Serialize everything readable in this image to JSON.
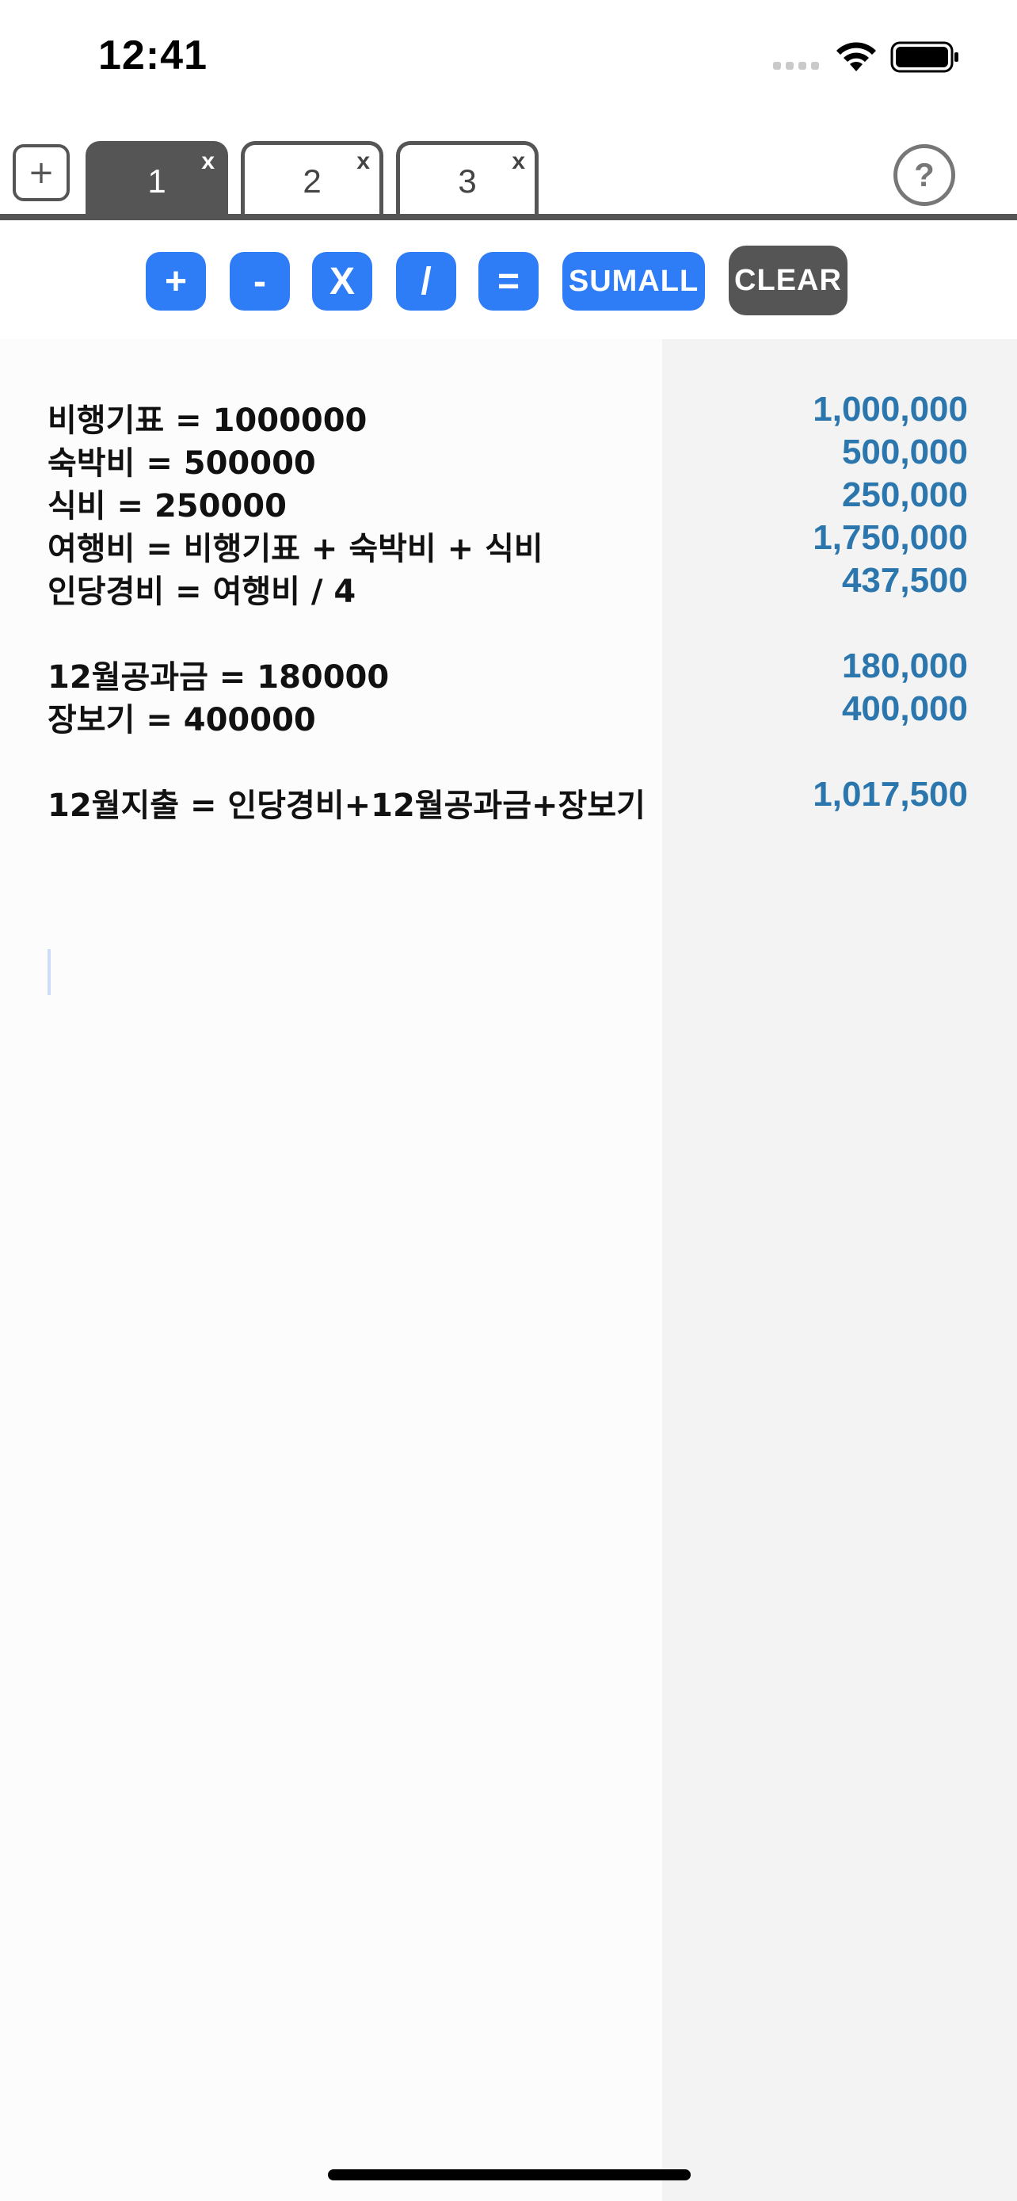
{
  "status_bar": {
    "time": "12:41"
  },
  "tabs": {
    "add_label": "+",
    "close_label": "x",
    "items": [
      {
        "label": "1",
        "active": true
      },
      {
        "label": "2",
        "active": false
      },
      {
        "label": "3",
        "active": false
      }
    ],
    "help_label": "?"
  },
  "toolbar": {
    "plus": "+",
    "minus": "-",
    "multiply": "X",
    "divide": "/",
    "equals": "=",
    "sumall": "SUMALL",
    "clear": "CLEAR"
  },
  "editor": {
    "lines": [
      "비행기표 = 1000000",
      "숙박비 = 500000",
      "식비 = 250000",
      "여행비 = 비행기표 + 숙박비 + 식비",
      "인당경비 = 여행비 / 4",
      "12월공과금 = 180000",
      "장보기 = 400000",
      "12월지출 = 인당경비+12월공과금+장보기"
    ]
  },
  "results": {
    "values": [
      "1,000,000",
      "500,000",
      "250,000",
      "1,750,000",
      "437,500",
      "180,000",
      "400,000",
      "1,017,500"
    ]
  },
  "colors": {
    "accent": "#2e7df7",
    "tab_active": "#555555",
    "result_text": "#2c76ae",
    "results_panel": "#f3f3f3"
  }
}
